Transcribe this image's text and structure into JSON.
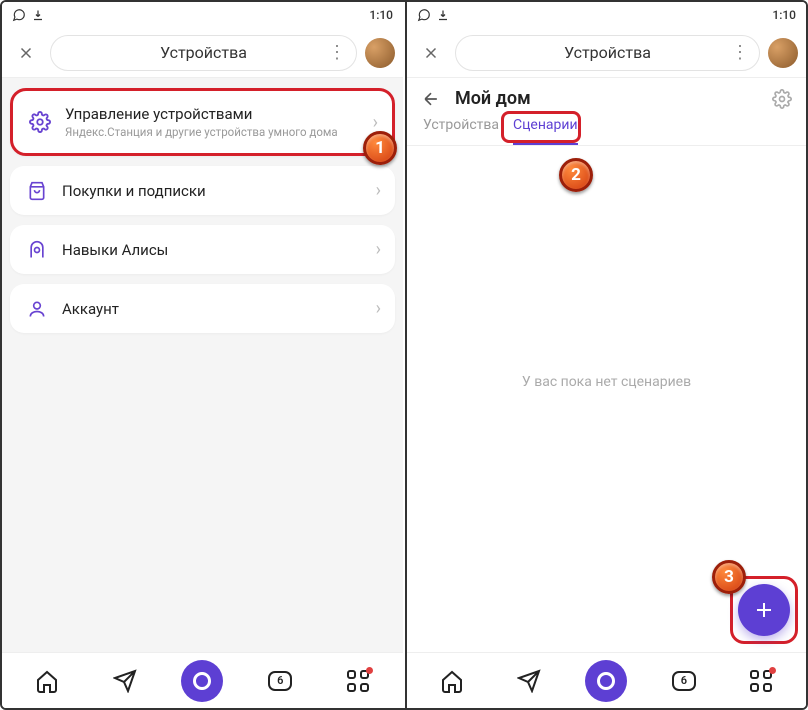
{
  "status": {
    "time": "1:10"
  },
  "screen1": {
    "header_title": "Устройства",
    "items": [
      {
        "title": "Управление устройствами",
        "subtitle": "Яндекс.Станция и другие устройства умного дома"
      },
      {
        "title": "Покупки и подписки"
      },
      {
        "title": "Навыки Алисы"
      },
      {
        "title": "Аккаунт"
      }
    ],
    "step_badge": "1",
    "nav_count": "6"
  },
  "screen2": {
    "header_title": "Устройства",
    "sub_title": "Мой дом",
    "tabs": [
      "Устройства",
      "Сценарии"
    ],
    "empty": "У вас пока нет сценариев",
    "step_badge_tab": "2",
    "step_badge_fab": "3",
    "nav_count": "6"
  }
}
